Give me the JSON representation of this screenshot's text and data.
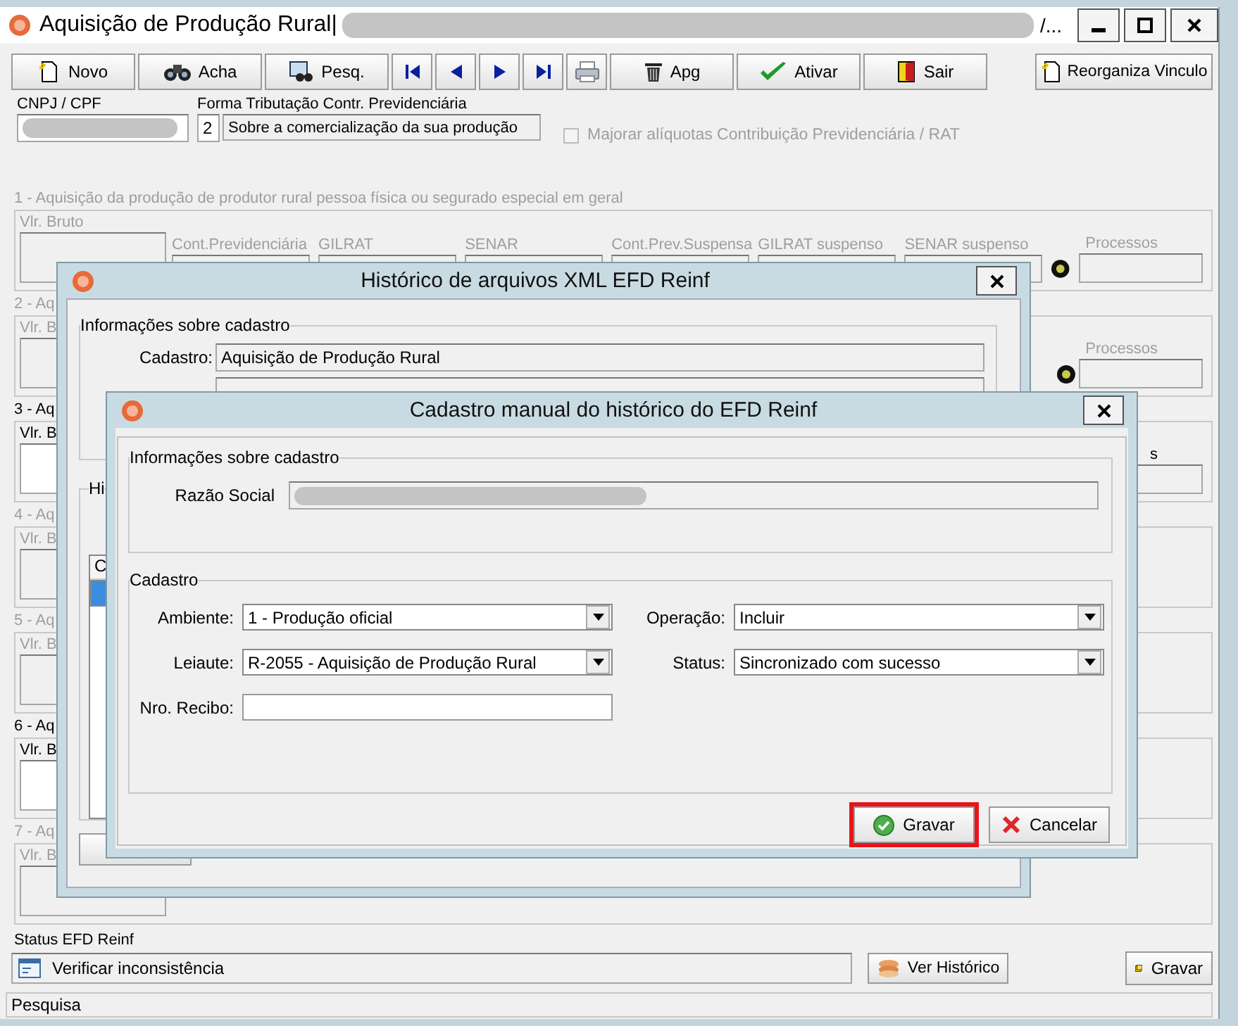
{
  "window": {
    "title": "Aquisição de Produção Rural|",
    "title_end": "/..."
  },
  "toolbar": [
    {
      "kind": "new",
      "label": "Novo"
    },
    {
      "kind": "find",
      "label": "Acha"
    },
    {
      "kind": "search",
      "label": "Pesq."
    },
    {
      "kind": "first"
    },
    {
      "kind": "prev"
    },
    {
      "kind": "next"
    },
    {
      "kind": "last"
    },
    {
      "kind": "print"
    },
    {
      "kind": "delete",
      "label": "Apg"
    },
    {
      "kind": "activate",
      "label": "Ativar"
    },
    {
      "kind": "exit",
      "label": "Sair"
    },
    {
      "kind": "reorganize",
      "label": "Reorganiza Vinculo"
    }
  ],
  "cnpj": {
    "label": "CNPJ / CPF"
  },
  "tributacao": {
    "label": "Forma Tributação Contr. Previdenciária",
    "code": "2",
    "value": "Sobre a comercialização da sua produção"
  },
  "majorar": {
    "label": "Majorar alíquotas Contribuição Previdenciária / RAT",
    "checked": false,
    "disabled": true
  },
  "section_1": {
    "title": "1 - Aquisição da produção de produtor rural pessoa física ou segurado especial em geral",
    "enabled": false,
    "gross_label": "Vlr. Bruto",
    "fields": [
      "Cont.Previdenciária",
      "GILRAT",
      "SENAR",
      "Cont.Prev.Suspensa",
      "GILRAT suspenso",
      "SENAR suspenso"
    ],
    "processes_label": "Processos",
    "light": true
  },
  "sections": [
    {
      "title": "2 - Aq",
      "enabled": false,
      "gross_label": "Vlr. B",
      "processes_label": "Processos",
      "light": true
    },
    {
      "title": "3 - Aq",
      "enabled": true,
      "gross_label": "Vlr. B",
      "processes_label": "s",
      "light": false
    },
    {
      "title": "4 - Aq",
      "enabled": false,
      "gross_label": "Vlr. B"
    },
    {
      "title": "5 - Aq",
      "enabled": false,
      "gross_label": "Vlr. B"
    },
    {
      "title": "6 - Aq",
      "enabled": true,
      "gross_label": "Vlr. B"
    },
    {
      "title": "7 - Aq",
      "enabled": false,
      "gross_label": "Vlr. B"
    }
  ],
  "status": {
    "label": "Status EFD Reinf",
    "value": "Verificar inconsistência",
    "history_button": "Ver Histórico",
    "save_button": "Gravar"
  },
  "status_bar": "Pesquisa",
  "history_dialog": {
    "title": "Histórico de arquivos XML EFD Reinf",
    "info_group": "Informações sobre cadastro",
    "cadastro_label": "Cadastro:",
    "cadastro_value": "Aquisição de Produção Rural",
    "history_group": "Hi",
    "list_header": "C",
    "list_rows": [
      {
        "selected": true
      }
    ]
  },
  "manual_dialog": {
    "title": "Cadastro manual do histórico do EFD Reinf",
    "info_group": "Informações sobre cadastro",
    "razao_label": "Razão Social",
    "cadastro_group": "Cadastro",
    "fields": [
      {
        "kind": "select",
        "label": "Ambiente:",
        "value": "1 - Produção oficial"
      },
      {
        "kind": "select",
        "label": "Operação:",
        "value": "Incluir"
      },
      {
        "kind": "select",
        "label": "Leiaute:",
        "value": "R-2055 - Aquisição de Produção Rural"
      },
      {
        "kind": "select",
        "label": "Status:",
        "value": "Sincronizado com sucesso"
      },
      {
        "kind": "text",
        "label": "Nro. Recibo:"
      }
    ],
    "buttons": [
      {
        "kind": "ok",
        "label": "Gravar",
        "highlighted": true
      },
      {
        "kind": "cancel",
        "label": "Cancelar",
        "highlighted": false
      }
    ]
  }
}
